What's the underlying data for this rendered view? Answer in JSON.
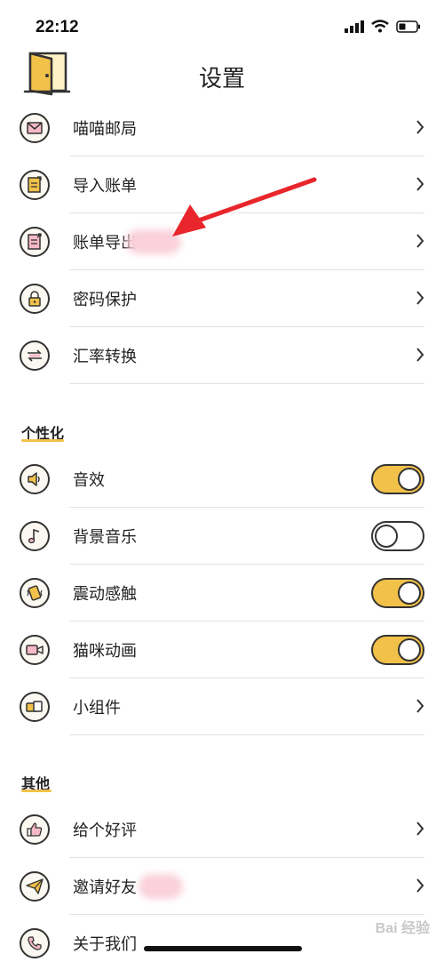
{
  "status": {
    "time": "22:12"
  },
  "header": {
    "title": "设置"
  },
  "account_items": [
    {
      "label": "喵喵邮局"
    },
    {
      "label": "导入账单"
    },
    {
      "label": "账单导出"
    },
    {
      "label": "密码保护"
    },
    {
      "label": "汇率转换"
    }
  ],
  "personalize": {
    "title": "个性化",
    "items": [
      {
        "label": "音效",
        "on": true
      },
      {
        "label": "背景音乐",
        "on": false
      },
      {
        "label": "震动感触",
        "on": true
      },
      {
        "label": "猫咪动画",
        "on": true
      },
      {
        "label": "小组件"
      }
    ]
  },
  "other": {
    "title": "其他",
    "items": [
      {
        "label": "给个好评"
      },
      {
        "label": "邀请好友"
      },
      {
        "label": "关于我们"
      }
    ]
  },
  "colors": {
    "accent": "#f2c14a",
    "annotation_arrow": "#e8262b"
  },
  "watermark": "Bai 经验"
}
